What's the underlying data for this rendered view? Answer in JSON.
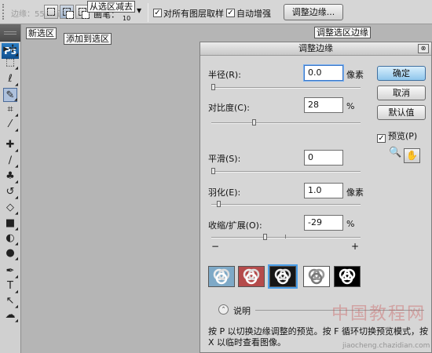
{
  "options_bar": {
    "faint_text": "边缘：55：F正常",
    "brush_label": "画笔：",
    "brush_size": "10",
    "sample_all_label": "对所有图层取样",
    "auto_enhance_label": "自动增强",
    "refine_button": "调整边缘..."
  },
  "callouts": {
    "subtract": "从选区减去",
    "new_sel": "新选区",
    "add_sel": "添加到选区",
    "refine": "调整选区边缘"
  },
  "toolbox": {
    "logo": "Ps",
    "tools": [
      {
        "name": "move-tool-icon",
        "glyph": "▸✢"
      },
      {
        "name": "marquee-tool-icon",
        "glyph": "⬚"
      },
      {
        "name": "lasso-tool-icon",
        "glyph": "ℓ"
      },
      {
        "name": "quick-selection-tool-icon",
        "glyph": "✎"
      },
      {
        "name": "crop-tool-icon",
        "glyph": "⌗"
      },
      {
        "name": "eyedropper-tool-icon",
        "glyph": "⁄"
      },
      {
        "name": "healing-brush-tool-icon",
        "glyph": "✚"
      },
      {
        "name": "brush-tool-icon",
        "glyph": "∕"
      },
      {
        "name": "clone-stamp-tool-icon",
        "glyph": "♣"
      },
      {
        "name": "history-brush-tool-icon",
        "glyph": "↺"
      },
      {
        "name": "eraser-tool-icon",
        "glyph": "◇"
      },
      {
        "name": "gradient-tool-icon",
        "glyph": "■"
      },
      {
        "name": "blur-tool-icon",
        "glyph": "◐"
      },
      {
        "name": "dodge-tool-icon",
        "glyph": "●"
      },
      {
        "name": "pen-tool-icon",
        "glyph": "✒"
      },
      {
        "name": "type-tool-icon",
        "glyph": "T"
      },
      {
        "name": "path-selection-tool-icon",
        "glyph": "↖"
      },
      {
        "name": "shape-tool-icon",
        "glyph": "☁"
      }
    ]
  },
  "dialog": {
    "title": "调整边缘",
    "radius_label": "半径(R):",
    "radius_value": "0.0",
    "radius_unit": "像素",
    "contrast_label": "对比度(C):",
    "contrast_value": "28",
    "contrast_unit": "%",
    "smooth_label": "平滑(S):",
    "smooth_value": "0",
    "feather_label": "羽化(E):",
    "feather_value": "1.0",
    "feather_unit": "像素",
    "contract_label": "收缩/扩展(O):",
    "contract_value": "-29",
    "contract_unit": "%",
    "minus": "−",
    "plus": "+",
    "ok": "确定",
    "cancel": "取消",
    "default": "默认值",
    "preview_label": "预览(P)",
    "description_label": "说明",
    "description_text": "按 P 以切换边缘调整的预览。按 F 循环切换预览模式，按 X 以临时查看图像。",
    "slider_levels": {
      "radius": 0.0,
      "contrast": 0.28,
      "smooth": 0.0,
      "feather": 0.04,
      "contract": 0.355
    }
  },
  "watermark": {
    "line1": "中国教程网",
    "line2": "jiaocheng.chazidian.com"
  }
}
